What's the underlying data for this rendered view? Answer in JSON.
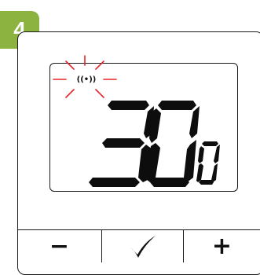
{
  "step": {
    "number": "4",
    "color": "#8cb33f"
  },
  "display": {
    "temperature": "30",
    "unit": "0",
    "signal_symbol": "((•))",
    "signal_blinking": true,
    "blink_color": "#e52329"
  },
  "buttons": {
    "minus_label": "−",
    "confirm_icon": "checkmark-icon",
    "plus_label": "+"
  }
}
